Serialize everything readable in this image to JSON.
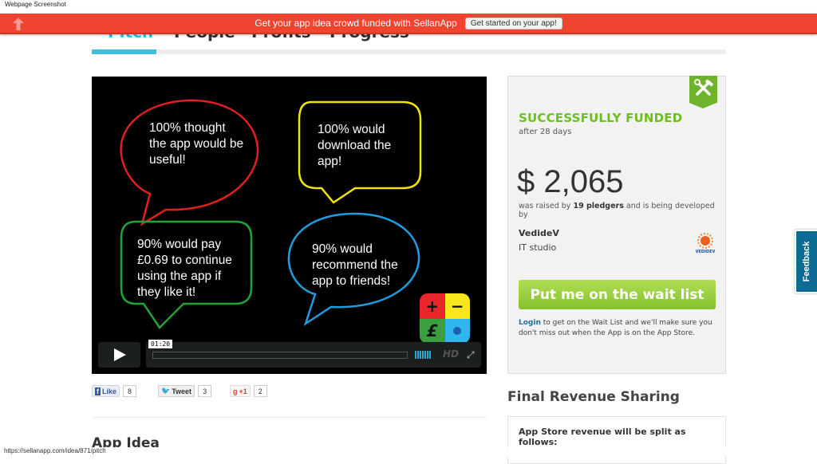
{
  "screenshot_label": "Webpage Screenshot",
  "topbar": {
    "message": "Get your app idea crowd funded with SellanApp",
    "cta_label": "Get started on your app!"
  },
  "tabs": [
    {
      "label": "Pitch",
      "active": true
    },
    {
      "label": "People",
      "active": false
    },
    {
      "label": "Profits",
      "active": false
    },
    {
      "label": "Progress",
      "active": false
    }
  ],
  "video": {
    "bubbles": [
      {
        "text": "100% thought the app would be useful!",
        "color": "#e02020"
      },
      {
        "text": "100% would download the app!",
        "color": "#f2e600"
      },
      {
        "text": "90% would pay £0.69 to continue using the app if they like it!",
        "color": "#22a33a"
      },
      {
        "text": "90% would recommend the app to friends!",
        "color": "#1e9ee0"
      }
    ],
    "app_icon": {
      "plus": "+",
      "minus": "−",
      "pound": "£"
    },
    "time": "01:20",
    "hd_label": "HD"
  },
  "social": {
    "like_label": "Like",
    "like_count": "8",
    "tweet_label": "Tweet",
    "tweet_count": "3",
    "plus_label": "+1",
    "plus_count": "2"
  },
  "section_app_idea": "App Idea",
  "status_url": "https://sellanapp.com/idea/871/pitch",
  "funding": {
    "status": "SUCCESSFULLY FUNDED",
    "duration": "after 28 days",
    "amount": "$ 2,065",
    "raised_prefix": "was raised by ",
    "pledgers": "19 pledgers",
    "raised_suffix": " and is being developed by",
    "developer_name": "VedideV",
    "developer_type": "IT studio",
    "developer_logo_text": "VEDIDEV",
    "wait_list_label": "Put me on the wait list",
    "login_label": "Login",
    "note": " to get on the Wait List and we'll make sure you don't miss out when the App is on the App Store."
  },
  "revenue": {
    "title": "Final Revenue Sharing",
    "intro": "App Store revenue will be split as follows:"
  },
  "feedback_label": "Feedback"
}
